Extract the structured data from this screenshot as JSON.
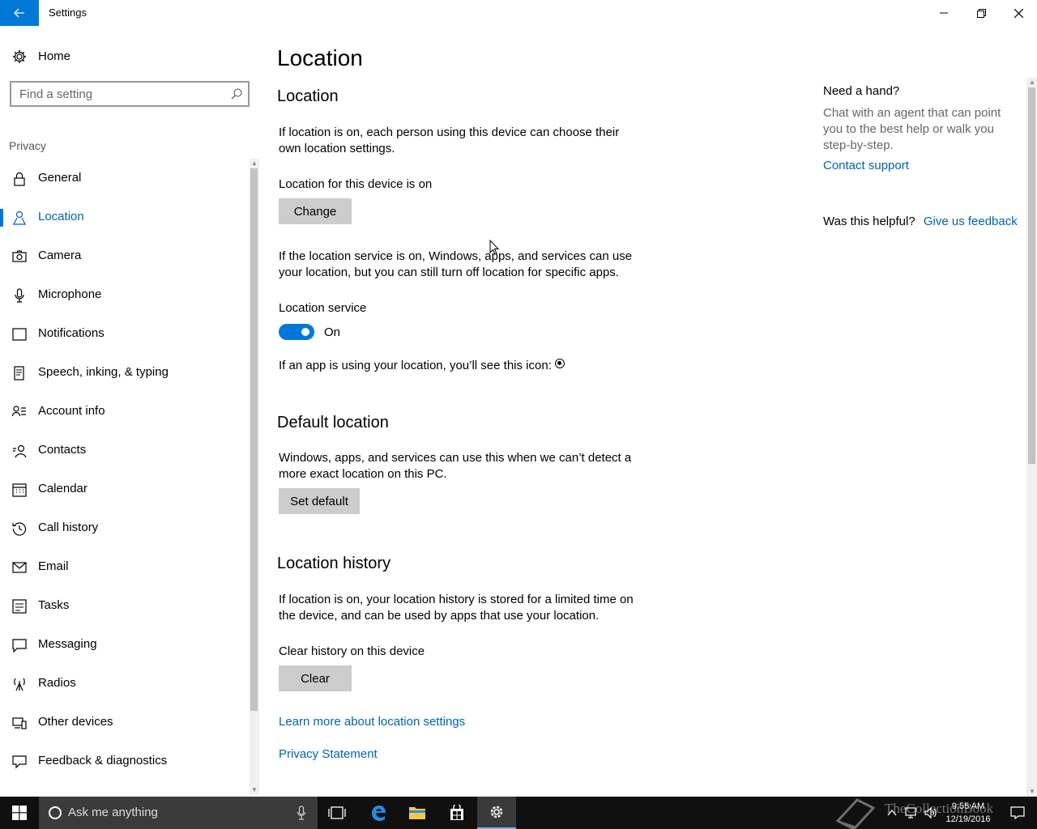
{
  "window": {
    "title": "Settings"
  },
  "sidebar": {
    "home_label": "Home",
    "search_placeholder": "Find a setting",
    "section_label": "Privacy",
    "items": [
      {
        "label": "General",
        "icon": "lock-icon"
      },
      {
        "label": "Location",
        "icon": "location-person-icon",
        "active": true
      },
      {
        "label": "Camera",
        "icon": "camera-icon"
      },
      {
        "label": "Microphone",
        "icon": "microphone-icon"
      },
      {
        "label": "Notifications",
        "icon": "notifications-icon"
      },
      {
        "label": "Speech, inking, & typing",
        "icon": "speech-icon"
      },
      {
        "label": "Account info",
        "icon": "account-info-icon"
      },
      {
        "label": "Contacts",
        "icon": "contacts-icon"
      },
      {
        "label": "Calendar",
        "icon": "calendar-icon"
      },
      {
        "label": "Call history",
        "icon": "history-icon"
      },
      {
        "label": "Email",
        "icon": "email-icon"
      },
      {
        "label": "Tasks",
        "icon": "tasks-icon"
      },
      {
        "label": "Messaging",
        "icon": "messaging-icon"
      },
      {
        "label": "Radios",
        "icon": "radios-icon"
      },
      {
        "label": "Other devices",
        "icon": "devices-icon"
      },
      {
        "label": "Feedback & diagnostics",
        "icon": "feedback-icon"
      }
    ]
  },
  "main": {
    "page_title": "Location",
    "location": {
      "heading": "Location",
      "intro": "If location is on, each person using this device can choose their own location settings.",
      "device_status": "Location for this device is on",
      "change_button": "Change",
      "service_desc": "If the location service is on, Windows, apps, and services can use your location, but you can still turn off location for specific apps.",
      "service_label": "Location service",
      "service_state": "On",
      "icon_note": "If an app is using your location, you’ll see this icon:"
    },
    "default_location": {
      "heading": "Default location",
      "desc": "Windows, apps, and services can use this when we can’t detect a more exact location on this PC.",
      "button": "Set default"
    },
    "history": {
      "heading": "Location history",
      "desc": "If location is on, your location history is stored for a limited time on the device, and can be used by apps that use your location.",
      "clear_label": "Clear history on this device",
      "button": "Clear"
    },
    "links": {
      "learn_more": "Learn more about location settings",
      "privacy": "Privacy Statement"
    }
  },
  "help": {
    "title": "Need a hand?",
    "text": "Chat with an agent that can point you to the best help or walk you step-by-step.",
    "contact": "Contact support",
    "helpful_q": "Was this helpful?",
    "feedback": "Give us feedback"
  },
  "taskbar": {
    "search_placeholder": "Ask me anything",
    "time": "9:55 AM",
    "date": "12/19/2016",
    "watermark": "TheCollectionBook"
  },
  "colors": {
    "accent": "#0078d7",
    "link": "#0063b1",
    "taskbar": "#101010"
  }
}
